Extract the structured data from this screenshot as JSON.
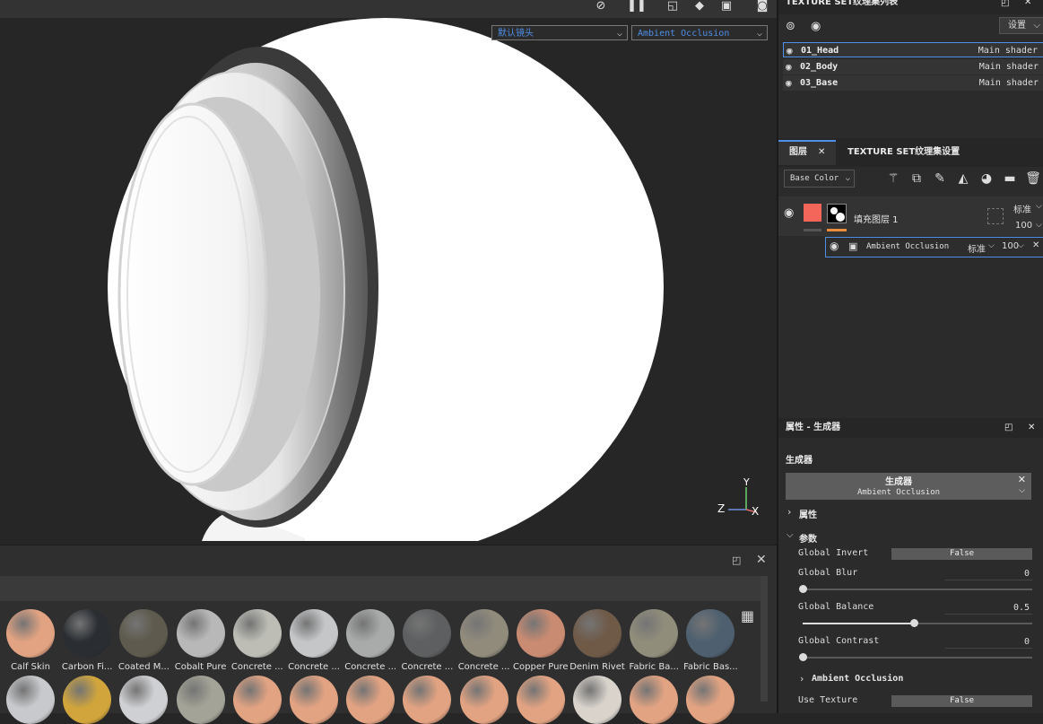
{
  "viewport": {
    "camera_select": "默认镜头",
    "channel_select": "Ambient Occlusion",
    "axis": {
      "z": "Z",
      "y": "Y",
      "x": "X"
    }
  },
  "shelf": {
    "materials_row1": [
      {
        "label": "Calf Skin",
        "color": "#e2a382"
      },
      {
        "label": "Carbon Fi...",
        "color": "#2a2e33"
      },
      {
        "label": "Coated M...",
        "color": "#5e5a4d"
      },
      {
        "label": "Cobalt Pure",
        "color": "#b8b8b8"
      },
      {
        "label": "Concrete ...",
        "color": "#bdbdb6"
      },
      {
        "label": "Concrete ...",
        "color": "#c4c6c8"
      },
      {
        "label": "Concrete ...",
        "color": "#a9abab"
      },
      {
        "label": "Concrete ...",
        "color": "#5d5f60"
      },
      {
        "label": "Concrete ...",
        "color": "#918b7c"
      },
      {
        "label": "Copper Pure",
        "color": "#c98b72"
      },
      {
        "label": "Denim Rivet",
        "color": "#6f5a48"
      },
      {
        "label": "Fabric Ba...",
        "color": "#918d7b"
      },
      {
        "label": "Fabric Bas...",
        "color": "#4e6070"
      }
    ],
    "materials_row2": [
      {
        "color": "#c7c9cc"
      },
      {
        "color": "#d1a53c"
      },
      {
        "color": "#cfd0d3"
      },
      {
        "color": "#a3a397"
      },
      {
        "color": "#e2a382"
      },
      {
        "color": "#e2a382"
      },
      {
        "color": "#e2a382"
      },
      {
        "color": "#e2a382"
      },
      {
        "color": "#e2a382"
      },
      {
        "color": "#e2a382"
      },
      {
        "color": "#d9d3cc"
      },
      {
        "color": "#e2a382"
      },
      {
        "color": "#e2a382"
      }
    ]
  },
  "texture_sets": {
    "title": "TEXTURE SET纹理集列表",
    "settings_label": "设置",
    "rows": [
      {
        "name": "01_Head",
        "shader": "Main shader"
      },
      {
        "name": "02_Body",
        "shader": "Main shader"
      },
      {
        "name": "03_Base",
        "shader": "Main shader"
      }
    ]
  },
  "layers": {
    "tab_layers": "图层",
    "tab_settings": "TEXTURE SET纹理集设置",
    "channel_select": "Base Color",
    "fill_layer": {
      "name": "填充图层 1",
      "blend": "标准",
      "opacity": "100",
      "color": "#f4655a"
    },
    "effect": {
      "name": "Ambient Occlusion",
      "blend": "标准",
      "opacity": "100"
    }
  },
  "properties": {
    "title": "属性 - 生成器",
    "section": "生成器",
    "generator_title": "生成器",
    "generator_name": "Ambient Occlusion",
    "group_attributes": "属性",
    "group_params": "参数",
    "params": {
      "global_invert_label": "Global Invert",
      "global_invert_value": "False",
      "global_blur_label": "Global Blur",
      "global_blur_value": "0",
      "global_balance_label": "Global Balance",
      "global_balance_value": "0.5",
      "global_contrast_label": "Global Contrast",
      "global_contrast_value": "0"
    },
    "group_ao": "Ambient Occlusion",
    "use_texture_label": "Use Texture",
    "use_texture_value": "False"
  }
}
